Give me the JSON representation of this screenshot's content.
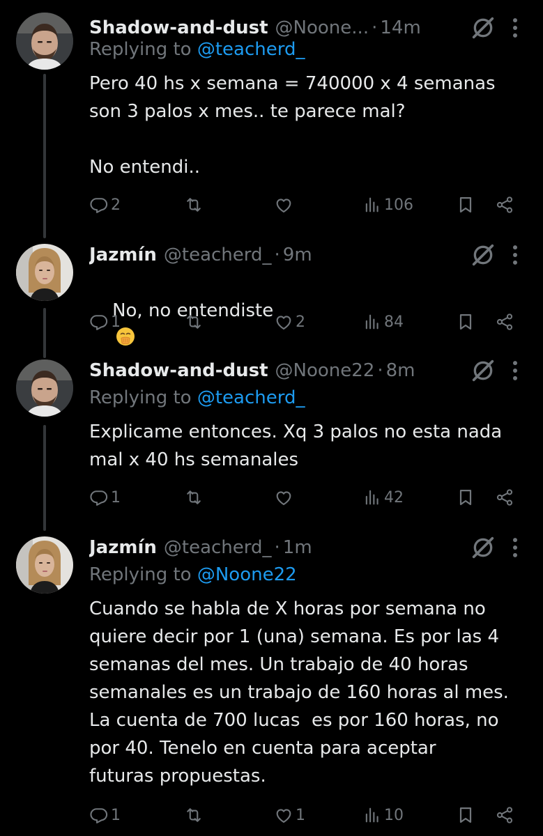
{
  "tweets": [
    {
      "name": "Shadow-and-dust",
      "handle": "@Noone...",
      "time": "14m",
      "replying_prefix": "Replying to ",
      "replying_to": "@teacherd_",
      "text": "Pero 40 hs x semana = 740000 x 4 semanas\nson 3 palos x mes.. te parece mal?\n\nNo entendi..",
      "replies": "2",
      "retweets": "",
      "likes": "",
      "views": "106"
    },
    {
      "name": "Jazmín",
      "handle": "@teacherd_",
      "time": "9m",
      "text": "No, no entendiste",
      "emoji": "face-with-hand-over-mouth",
      "replies": "1",
      "retweets": "",
      "likes": "2",
      "views": "84"
    },
    {
      "name": "Shadow-and-dust",
      "handle": "@Noone22",
      "time": "8m",
      "replying_prefix": "Replying to ",
      "replying_to": "@teacherd_",
      "text": "Explicame entonces. Xq 3 palos no esta nada\nmal x 40 hs semanales",
      "replies": "1",
      "retweets": "",
      "likes": "",
      "views": "42"
    },
    {
      "name": "Jazmín",
      "handle": "@teacherd_",
      "time": "1m",
      "replying_prefix": "Replying to ",
      "replying_to": "@Noone22",
      "text": "Cuando se habla de X horas por semana no\nquiere decir por 1 (una) semana. Es por las 4\nsemanas del mes. Un trabajo de 40 horas\nsemanales es un trabajo de 160 horas al mes.\nLa cuenta de 700 lucas  es por 160 horas, no\npor 40. Tenelo en cuenta para aceptar\nfuturas propuestas.",
      "replies": "1",
      "retweets": "",
      "likes": "1",
      "views": "10"
    }
  ],
  "separator": "·",
  "colors": {
    "background": "#000000",
    "text": "#e7e9ea",
    "muted": "#71767b",
    "link": "#1d9bf0",
    "thread_line": "#333639"
  },
  "icons": [
    "reply-icon",
    "retweet-icon",
    "like-icon",
    "views-icon",
    "bookmark-icon",
    "share-icon",
    "grok-icon",
    "more-icon"
  ]
}
